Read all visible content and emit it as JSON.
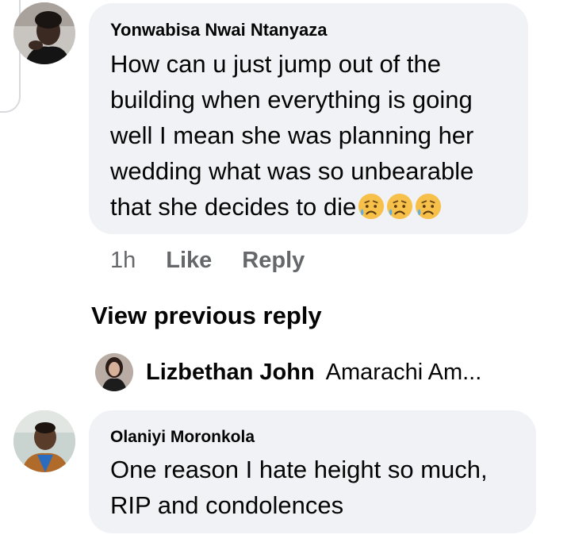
{
  "comments": [
    {
      "author": "Yonwabisa Nwai Ntanyaza",
      "text": "How can u just jump out of the building when everything is going well I mean she was planning her wedding what was so unbearable that she decides to die",
      "emoji_icons": [
        "sad-but-relieved-face-icon",
        "sad-but-relieved-face-icon",
        "sad-but-relieved-face-icon"
      ],
      "time": "1h",
      "like_label": "Like",
      "reply_label": "Reply"
    },
    {
      "author": "Olaniyi Moronkola",
      "text": "One reason I hate height so much, RIP and condolences"
    }
  ],
  "view_previous_label": "View previous reply",
  "reply_preview": {
    "name": "Lizbethan John",
    "snippet": "Amarachi Am..."
  },
  "colors": {
    "bubble": "#f0f2f5",
    "meta": "#65676b",
    "text": "#050505"
  }
}
